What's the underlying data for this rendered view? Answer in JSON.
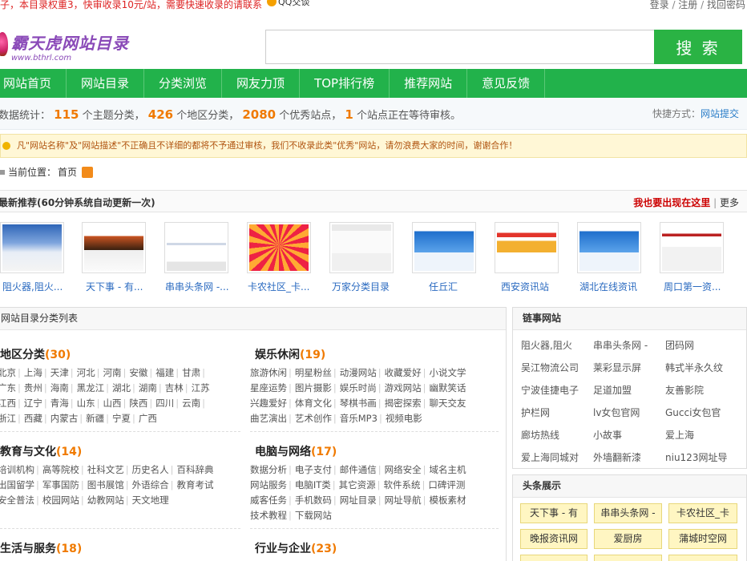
{
  "top": {
    "notice": "子，本目录权重3，快审收录10元/站，需要快速收录的请联系",
    "qq": "QQ交谈",
    "links": [
      "登录",
      "注册",
      "找回密码"
    ]
  },
  "logo": {
    "title": "霸天虎网站目录",
    "url": "www.bthrl.com"
  },
  "search": {
    "placeholder": "",
    "button": "搜 索"
  },
  "nav": [
    "网站首页",
    "网站目录",
    "分类浏览",
    "网友力顶",
    "TOP排行榜",
    "推荐网站",
    "意见反馈"
  ],
  "stats": {
    "prefix": "数据统计：",
    "themes": "115",
    "themes_label": "个主题分类，",
    "regions": "426",
    "regions_label": "个地区分类，",
    "sites": "2080",
    "sites_label": "个优秀站点，",
    "pending": "1",
    "pending_label": "个站点正在等待审核。",
    "quick_label": "快捷方式：",
    "quick_link": "网站提交"
  },
  "warning": "凡\"网站名称\"及\"网站描述\"不正确且不详细的都将不予通过审核，我们不收录此类\"优秀\"网站，请勿浪费大家的时间，谢谢合作！",
  "breadcrumb": {
    "label": "当前位置：",
    "home": "首页"
  },
  "latest": {
    "title": "最新推荐(60分钟系统自动更新一次)",
    "appear": "我也要出现在这里",
    "sep": "|",
    "more": "更多",
    "items": [
      "阻火器,阻火...",
      "天下事 - 有...",
      "串串头条网 -...",
      "卡农社区_卡...",
      "万家分类目录",
      "任丘汇",
      "西安资讯站",
      "湖北在线资讯",
      "周口第一资..."
    ]
  },
  "categories": {
    "title": "网站目录分类列表",
    "groups": [
      {
        "name": "地区分类",
        "count": "(30)",
        "rows": [
          [
            "北京",
            "上海",
            "天津",
            "河北",
            "河南",
            "安徽",
            "福建",
            "甘肃"
          ],
          [
            "广东",
            "贵州",
            "海南",
            "黑龙江",
            "湖北",
            "湖南",
            "吉林",
            "江苏"
          ],
          [
            "江西",
            "辽宁",
            "青海",
            "山东",
            "山西",
            "陕西",
            "四川",
            "云南"
          ],
          [
            "浙江",
            "西藏",
            "内蒙古",
            "新疆",
            "宁夏",
            "广西"
          ]
        ]
      },
      {
        "name": "娱乐休闲",
        "count": "(19)",
        "rows": [
          [
            "旅游休闲",
            "明星粉丝",
            "动漫网站",
            "收藏爱好",
            "小说文学"
          ],
          [
            "星座运势",
            "图片摄影",
            "娱乐时尚",
            "游戏网站",
            "幽默笑话"
          ],
          [
            "兴趣爱好",
            "体育文化",
            "琴棋书画",
            "揭密探索",
            "聊天交友"
          ],
          [
            "曲艺演出",
            "艺术创作",
            "音乐MP3",
            "视频电影"
          ]
        ]
      },
      {
        "name": "教育与文化",
        "count": "(14)",
        "rows": [
          [
            "培训机构",
            "高等院校",
            "社科文艺",
            "历史名人",
            "百科辞典"
          ],
          [
            "出国留学",
            "军事国防",
            "图书展馆",
            "外语综合",
            "教育考试"
          ],
          [
            "安全普法",
            "校园网站",
            "幼教网站",
            "天文地理"
          ]
        ]
      },
      {
        "name": "电脑与网络",
        "count": "(17)",
        "rows": [
          [
            "数据分析",
            "电子支付",
            "邮件通信",
            "网络安全",
            "域名主机"
          ],
          [
            "网站服务",
            "电脑IT类",
            "其它资源",
            "软件系统",
            "口碑评测"
          ],
          [
            "威客任务",
            "手机数码",
            "网址目录",
            "网址导航",
            "模板素材"
          ],
          [
            "技术教程",
            "下载网站"
          ]
        ]
      },
      {
        "name": "生活与服务",
        "count": "(18)",
        "rows": []
      },
      {
        "name": "行业与企业",
        "count": "(23)",
        "rows": []
      }
    ]
  },
  "links": {
    "title": "链事网站",
    "items": [
      [
        "阻火器,阻火",
        "串串头条网 -",
        "团码网"
      ],
      [
        "吴江物流公司",
        "莱彩显示屏",
        "韩式半永久纹"
      ],
      [
        "宁波佳捷电子",
        "足道加盟",
        "友善影院"
      ],
      [
        "护栏网",
        "lv女包官网",
        "Gucci女包官"
      ],
      [
        "廊坊热线",
        "小故事",
        "爱上海"
      ],
      [
        "爱上海同城对",
        "外墙翻新漆",
        "niu123网址导"
      ]
    ]
  },
  "showcase": {
    "title": "头条展示",
    "items": [
      [
        "天下事 - 有",
        "串串头条网 -",
        "卡农社区_卡"
      ],
      [
        "晚报资讯网",
        "爱厨房",
        "蒲城时空网"
      ],
      [
        "",
        "",
        ""
      ]
    ]
  }
}
